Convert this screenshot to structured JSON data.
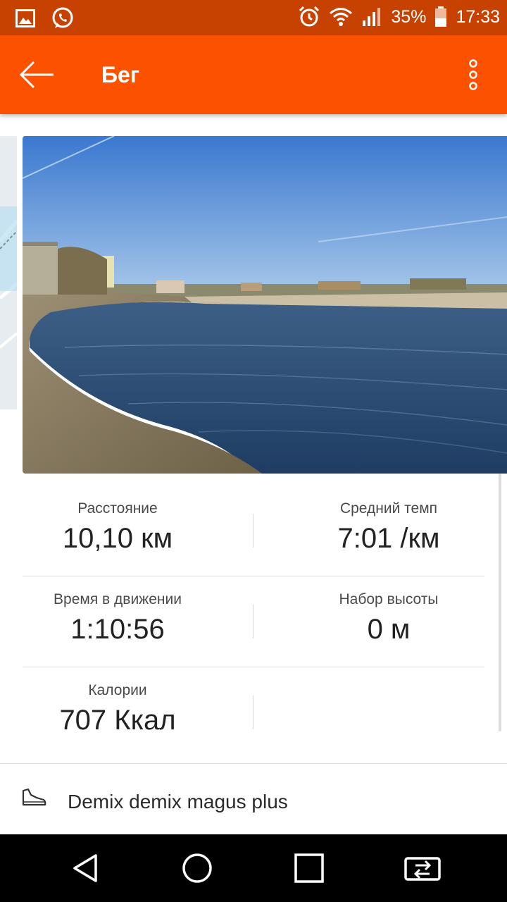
{
  "status_bar": {
    "battery_percent": "35%",
    "time": "17:33",
    "icons": [
      "gallery-icon",
      "whatsapp-icon",
      "alarm-icon",
      "wifi-icon",
      "signal-icon",
      "battery-icon"
    ]
  },
  "app_bar": {
    "title": "Бег",
    "back_icon": "arrow-left-icon",
    "more_icon": "more-vertical-icon",
    "color": "#fc5200"
  },
  "stats": {
    "distance": {
      "label": "Расстояние",
      "value": "10,10 км"
    },
    "pace": {
      "label": "Средний темп",
      "value": "7:01 /км"
    },
    "moving_time": {
      "label": "Время в движении",
      "value": "1:10:56"
    },
    "elevation": {
      "label": "Набор высоты",
      "value": "0 м"
    },
    "calories": {
      "label": "Калории",
      "value": "707 Ккал"
    }
  },
  "gear": {
    "icon": "shoe-icon",
    "name": "Demix demix magus plus"
  },
  "nav_bar": {
    "icons": [
      "back-triangle-icon",
      "home-circle-icon",
      "recents-square-icon",
      "switch-apps-icon"
    ]
  }
}
